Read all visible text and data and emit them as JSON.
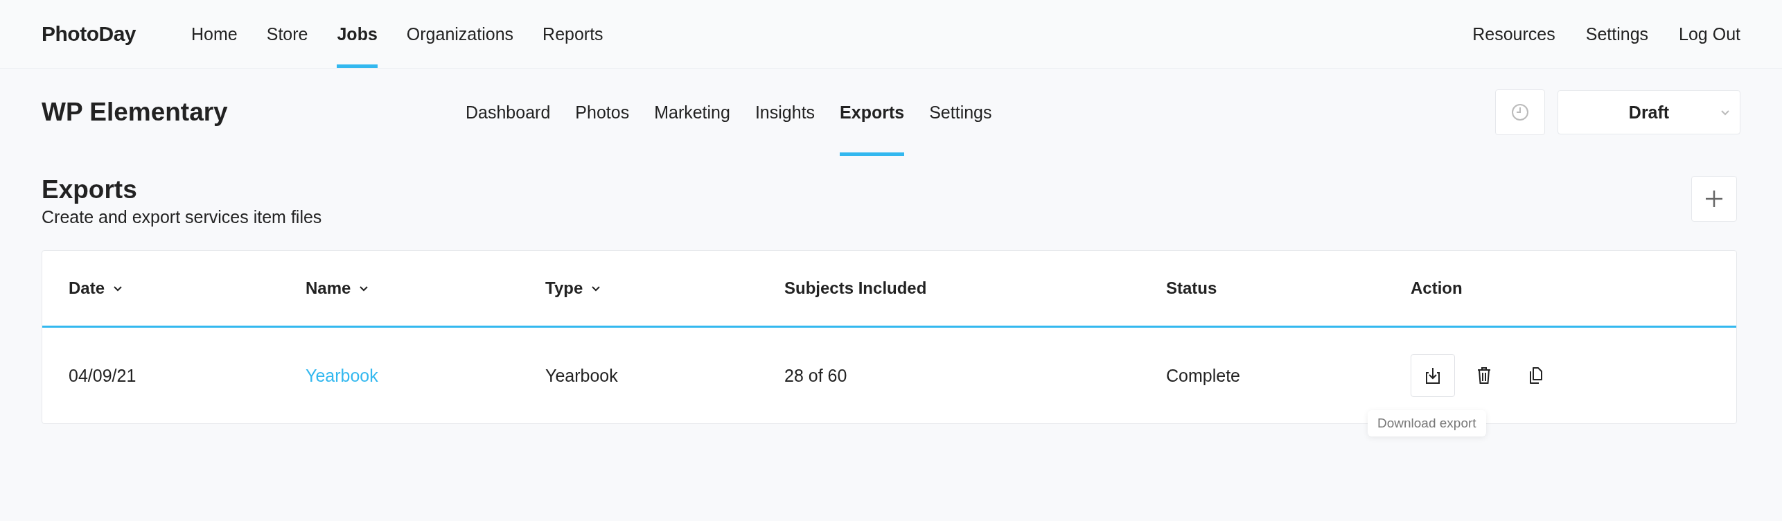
{
  "topbar": {
    "logo": "PhotoDay",
    "nav": [
      {
        "label": "Home",
        "selected": false
      },
      {
        "label": "Store",
        "selected": false
      },
      {
        "label": "Jobs",
        "selected": true
      },
      {
        "label": "Organizations",
        "selected": false
      },
      {
        "label": "Reports",
        "selected": false
      }
    ],
    "links": [
      "Resources",
      "Settings",
      "Log Out"
    ]
  },
  "job": {
    "title": "WP Elementary",
    "tabs": [
      {
        "label": "Dashboard",
        "selected": false
      },
      {
        "label": "Photos",
        "selected": false
      },
      {
        "label": "Marketing",
        "selected": false
      },
      {
        "label": "Insights",
        "selected": false
      },
      {
        "label": "Exports",
        "selected": true
      },
      {
        "label": "Settings",
        "selected": false
      }
    ],
    "status_select": {
      "value": "Draft"
    }
  },
  "exports": {
    "title": "Exports",
    "subtitle": "Create and export services item files",
    "table": {
      "columns": [
        {
          "label": "Date",
          "sortable": true
        },
        {
          "label": "Name",
          "sortable": true
        },
        {
          "label": "Type",
          "sortable": true
        },
        {
          "label": "Subjects Included",
          "sortable": false
        },
        {
          "label": "Status",
          "sortable": false
        },
        {
          "label": "Action",
          "sortable": false
        }
      ],
      "rows": [
        {
          "date": "04/09/21",
          "name": "Yearbook",
          "type": "Yearbook",
          "subjects": "28 of 60",
          "status": "Complete",
          "actions": [
            {
              "kind": "download",
              "hovered": true
            },
            {
              "kind": "delete",
              "hovered": false
            },
            {
              "kind": "copy",
              "hovered": false
            }
          ]
        }
      ]
    },
    "tooltip": "Download export"
  }
}
